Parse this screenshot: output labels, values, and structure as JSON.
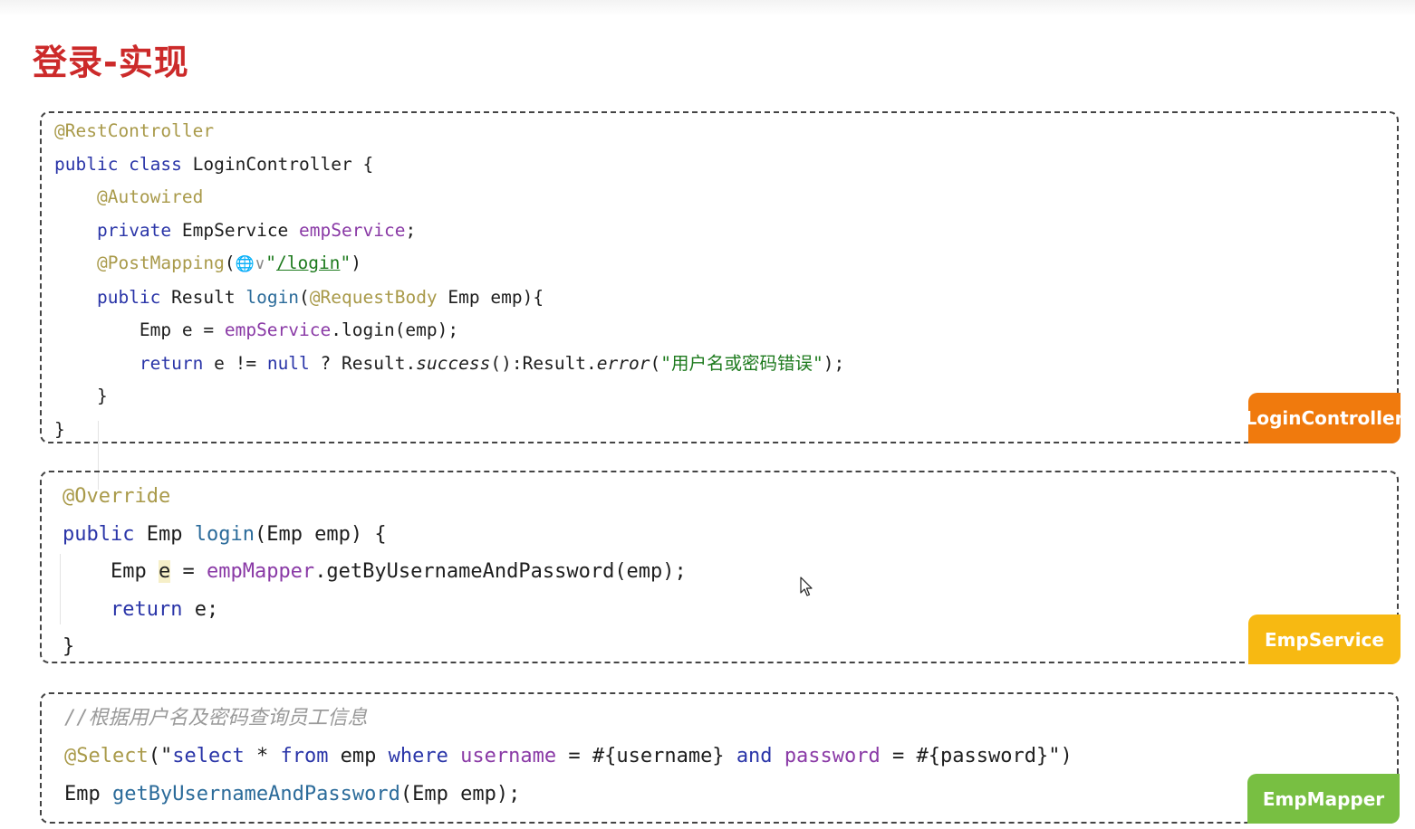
{
  "page": {
    "title": "登录-实现"
  },
  "login_controller": {
    "tag": "LoginController",
    "l1_annotation": "@RestController",
    "l2_kw": "public class",
    "l2_rest": " LoginController {",
    "l3_annotation": "@Autowired",
    "l4_kw": "private",
    "l4_type": " EmpService ",
    "l4_field": "empService",
    "l4_end": ";",
    "l5_annotation": "@PostMapping",
    "l5_open": "(",
    "l5_quote1": "\"",
    "l5_path": "/login",
    "l5_quote2": "\"",
    "l5_close": ")",
    "l6_kw": "public",
    "l6_type": " Result ",
    "l6_method": "login",
    "l6_open": "(",
    "l6_annotation": "@RequestBody",
    "l6_rest": " Emp emp){",
    "l7_start": "Emp e = ",
    "l7_field": "empService",
    "l7_rest": ".login(emp);",
    "l8_kw1": "return",
    "l8_mid": " e != ",
    "l8_kw2": "null",
    "l8_mid2": " ? Result.",
    "l8_success": "success",
    "l8_mid3": "():Result.",
    "l8_error": "error",
    "l8_open": "(",
    "l8_str": "\"用户名或密码错误\"",
    "l8_end": ");",
    "l9": "}",
    "l10": "}"
  },
  "emp_service": {
    "tag": "EmpService",
    "l1_annotation": "@Override",
    "l2_kw": "public",
    "l2_type": " Emp ",
    "l2_method": "login",
    "l2_rest": "(Emp emp) {",
    "l3_type": "Emp ",
    "l3_var": "e",
    "l3_eq": " = ",
    "l3_field": "empMapper",
    "l3_rest": ".getByUsernameAndPassword(emp);",
    "l4_kw": "return",
    "l4_rest": " e;",
    "l5": "}"
  },
  "emp_mapper": {
    "tag": "EmpMapper",
    "l1_comment": "//根据用户名及密码查询员工信息",
    "l2_annotation": "@Select",
    "l2_open": "(\"",
    "l2_select": "select",
    "l2_star": " * ",
    "l2_from": "from",
    "l2_emp": " emp ",
    "l2_where": "where",
    "l2_sp1": " ",
    "l2_username": "username",
    "l2_eq1": " = #{username} ",
    "l2_and": "and",
    "l2_sp2": " ",
    "l2_password": "password",
    "l2_eq2": " = #{password}\")",
    "l3_type": "Emp ",
    "l3_method": "getByUsernameAndPassword",
    "l3_rest": "(Emp emp);"
  }
}
